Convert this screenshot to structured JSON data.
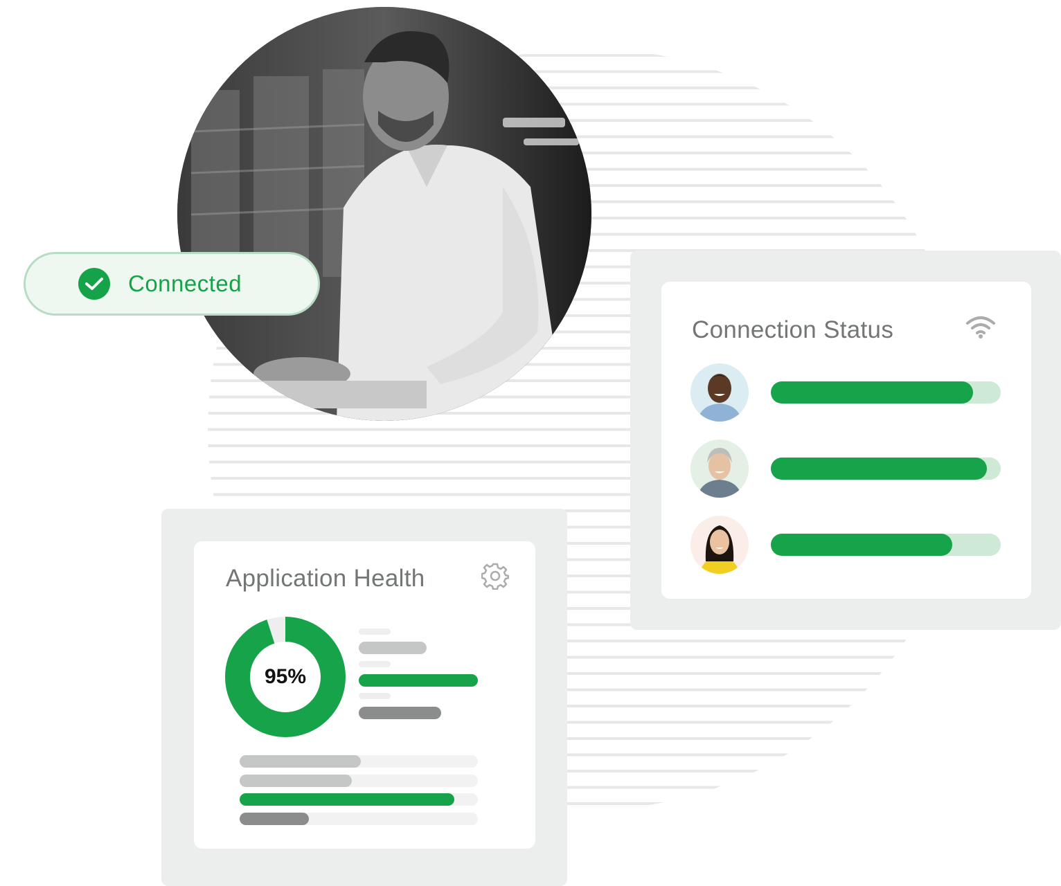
{
  "status_pill": {
    "label": "Connected",
    "state": "connected"
  },
  "hero_photo": {
    "subject": "man working at laptop in warehouse"
  },
  "connection_status": {
    "title": "Connection Status",
    "icon": "wifi-icon",
    "users": [
      {
        "avatar": "avatar-man-smiling",
        "signal": 0.88
      },
      {
        "avatar": "avatar-older-woman",
        "signal": 0.94
      },
      {
        "avatar": "avatar-young-woman",
        "signal": 0.79
      }
    ]
  },
  "application_health": {
    "title": "Application Health",
    "icon": "gear-icon",
    "health_value": "95%",
    "health_fraction": 0.95,
    "side_bars": [
      {
        "color": "#c4c7c5",
        "fill": 0.57
      },
      {
        "color": "#17a349",
        "fill": 1.0
      },
      {
        "color": "#8a8d8b",
        "fill": 0.69
      }
    ],
    "bottom_bars": [
      {
        "color": "#c4c7c5",
        "fill": 0.51
      },
      {
        "color": "#c4c7c5",
        "fill": 0.47
      },
      {
        "color": "#17a349",
        "fill": 0.9
      },
      {
        "color": "#8a8d8b",
        "fill": 0.29
      }
    ]
  },
  "colors": {
    "accent": "#17a349",
    "panel": "#eceeed",
    "text_muted": "#737773"
  }
}
